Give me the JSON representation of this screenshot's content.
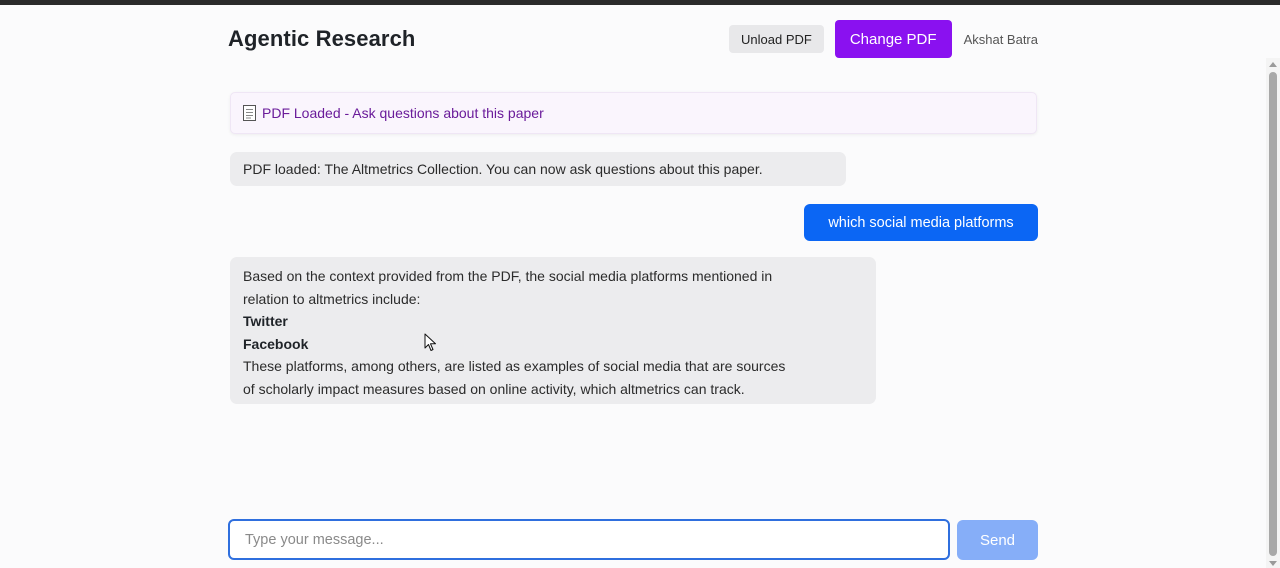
{
  "header": {
    "title": "Agentic Research",
    "unload_label": "Unload PDF",
    "change_label": "Change PDF",
    "user_name": "Akshat Batra"
  },
  "banner": {
    "icon": "document-icon",
    "text": "PDF Loaded - Ask questions about this paper"
  },
  "messages": {
    "system": "PDF loaded: The Altmetrics Collection. You can now ask questions about this paper.",
    "user": "which social media platforms",
    "bot": {
      "line1": "Based on the context provided from the PDF, the social media platforms mentioned in",
      "line2": "relation to altmetrics include:",
      "item1": "Twitter",
      "item2": "Facebook",
      "line3": "These platforms, among others, are listed as examples of social media that are sources",
      "line4": "of scholarly impact measures based on online activity, which altmetrics can track."
    }
  },
  "composer": {
    "placeholder": "Type your message...",
    "value": "",
    "send_label": "Send"
  },
  "colors": {
    "accent_purple": "#8a11f0",
    "user_bubble": "#0b66f4",
    "send_disabled": "#86aef8",
    "banner_text": "#6a1b9a"
  }
}
